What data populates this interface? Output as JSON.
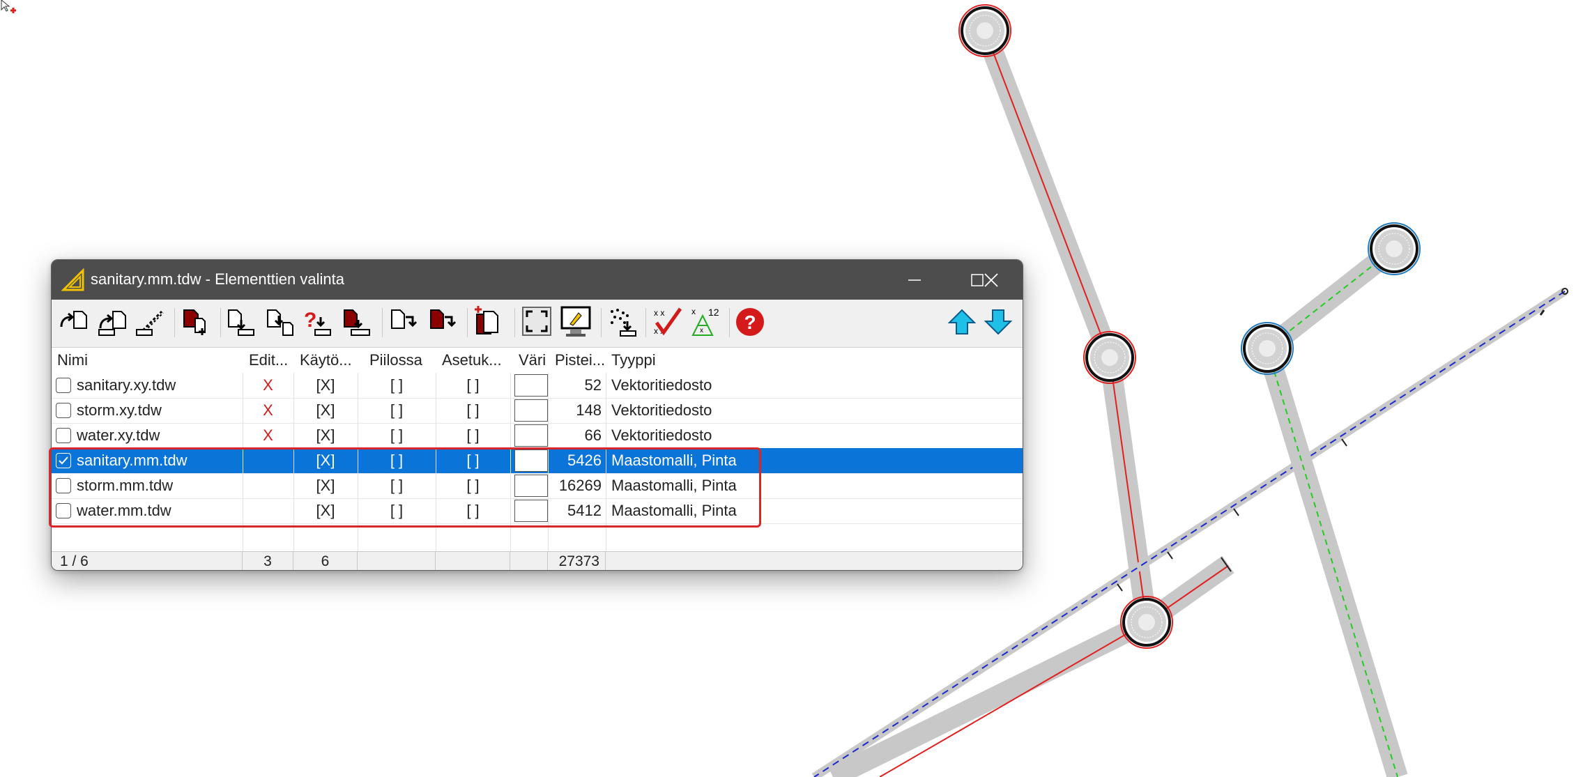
{
  "window": {
    "title": "sanitary.mm.tdw - Elementtien valinta",
    "icon": "triangle-ruler-icon",
    "controls": [
      "minimize-icon",
      "maximize-icon",
      "close-icon"
    ]
  },
  "toolbar": {
    "buttons": [
      "open-vector-file-icon",
      "open-file-alt-icon",
      "open-raster-icon",
      "new-element-icon",
      "export-icon",
      "export-alt-icon",
      "query-export-icon",
      "copy-export-icon",
      "move-down-icon",
      "move-alt-icon",
      "duplicate-icon",
      "zoom-extents-icon",
      "display-settings-icon",
      "scatter-points-icon",
      "check-points-icon",
      "tin-points-icon",
      "help-icon",
      "move-up-arrow-icon",
      "move-down-arrow-icon"
    ]
  },
  "columns": [
    "Nimi",
    "Edit...",
    "Käytö...",
    "Piilossa",
    "Asetuk...",
    "Väri",
    "Pistei...",
    "Tyyppi"
  ],
  "rows": [
    {
      "checked": false,
      "name": "sanitary.xy.tdw",
      "edit": "X",
      "use": "[X]",
      "hidden": "[ ]",
      "settings": "[ ]",
      "points": "52",
      "type": "Vektoritiedosto",
      "selected": false
    },
    {
      "checked": false,
      "name": "storm.xy.tdw",
      "edit": "X",
      "use": "[X]",
      "hidden": "[ ]",
      "settings": "[ ]",
      "points": "148",
      "type": "Vektoritiedosto",
      "selected": false
    },
    {
      "checked": false,
      "name": "water.xy.tdw",
      "edit": "X",
      "use": "[X]",
      "hidden": "[ ]",
      "settings": "[ ]",
      "points": "66",
      "type": "Vektoritiedosto",
      "selected": false
    },
    {
      "checked": true,
      "name": "sanitary.mm.tdw",
      "edit": "",
      "use": "[X]",
      "hidden": "[ ]",
      "settings": "[ ]",
      "points": "5426",
      "type": "Maastomalli, Pinta",
      "selected": true
    },
    {
      "checked": false,
      "name": "storm.mm.tdw",
      "edit": "",
      "use": "[X]",
      "hidden": "[ ]",
      "settings": "[ ]",
      "points": "16269",
      "type": "Maastomalli, Pinta",
      "selected": false
    },
    {
      "checked": false,
      "name": "water.mm.tdw",
      "edit": "",
      "use": "[X]",
      "hidden": "[ ]",
      "settings": "[ ]",
      "points": "5412",
      "type": "Maastomalli, Pinta",
      "selected": false
    }
  ],
  "status": {
    "count": "1 / 6",
    "edit": "3",
    "use": "6",
    "hidden": "",
    "settings": "",
    "color": "",
    "points": "27373"
  },
  "colors": {
    "selection": "#0a74d8",
    "highlight_box": "#d8262c",
    "titlebar": "#4d4d4d",
    "edit_mark": "#d41a1a",
    "pipe": "#c8c8c8"
  }
}
